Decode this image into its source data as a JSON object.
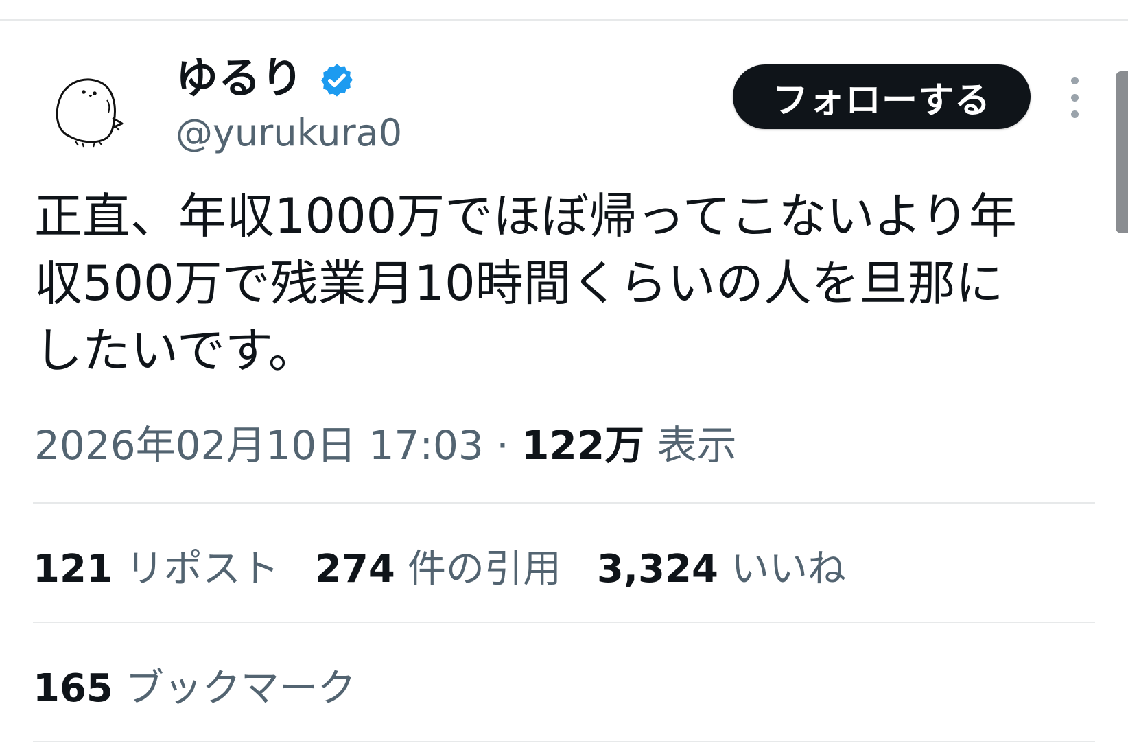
{
  "tweet": {
    "author": {
      "display_name": "ゆるり",
      "handle": "@yurukura0",
      "verified": true,
      "avatar_icon": "bird-avatar-icon"
    },
    "follow_label": "フォローする",
    "more_icon": "more-vertical-icon",
    "text": "正直、年収1000万でほぼ帰ってこないより年\n収500万で残業月10時間くらいの人を旦那に\nしたいです。",
    "timestamp": "2026年02月10日 17:03",
    "separator": "·",
    "views_count": "122万",
    "views_label": "表示",
    "stats": [
      {
        "count": "121",
        "label": "リポスト"
      },
      {
        "count": "274",
        "label": "件の引用"
      },
      {
        "count": "3,324",
        "label": "いいね"
      }
    ],
    "bookmarks": {
      "count": "165",
      "label": "ブックマーク"
    }
  },
  "colors": {
    "text_primary": "#0f1419",
    "text_secondary": "#536471",
    "verified_blue": "#1d9bf0",
    "follow_bg": "#0f1419",
    "divider": "#e7e9ea"
  }
}
